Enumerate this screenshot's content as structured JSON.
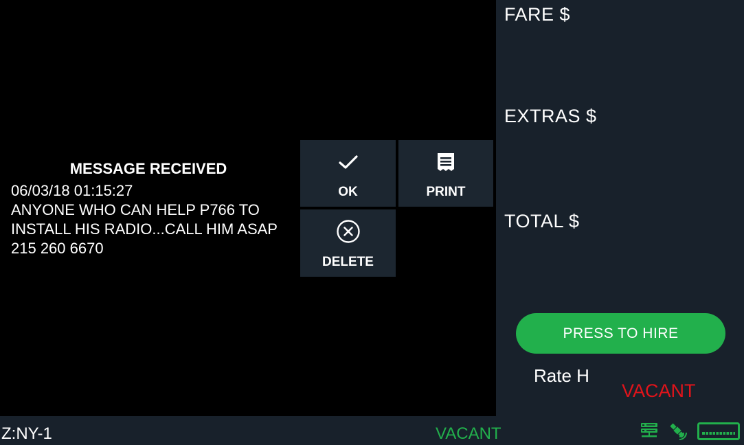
{
  "message": {
    "title": "MESSAGE RECEIVED",
    "lines": [
      "06/03/18 01:15:27",
      "ANYONE WHO CAN HELP P766 TO",
      "INSTALL HIS RADIO...CALL HIM ASAP",
      "215 260 6670"
    ]
  },
  "actions": {
    "ok": {
      "label": "OK",
      "icon": "checkmark-icon"
    },
    "print": {
      "label": "PRINT",
      "icon": "receipt-icon"
    },
    "delete": {
      "label": "DELETE",
      "icon": "circle-x-icon"
    }
  },
  "fare": {
    "fare_label": "FARE $",
    "extras_label": "EXTRAS $",
    "total_label": "TOTAL $",
    "hire_button": "PRESS TO HIRE",
    "rate": "Rate H",
    "status": "VACANT"
  },
  "status_bar": {
    "zone": "Z:NY-1",
    "status": "VACANT",
    "icons": [
      "server-icon",
      "satellite-icon",
      "meter-display-icon"
    ]
  },
  "colors": {
    "panel": "#18212b",
    "tile": "#1c2630",
    "accent_green": "#22b04c",
    "status_red": "#e0141b"
  }
}
